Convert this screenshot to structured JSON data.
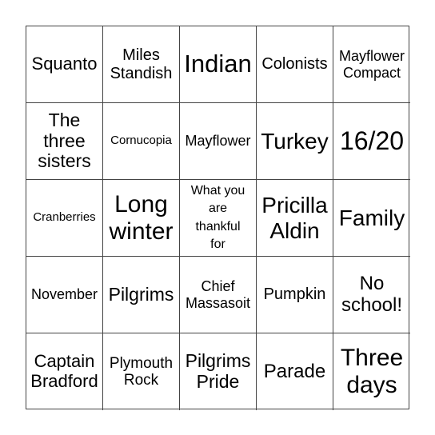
{
  "cells": [
    "Squanto",
    "Miles\nStandish",
    "Indian",
    "Colonists",
    "Mayflower\nCompact",
    "The\nthree\nsisters",
    "Cornucopia",
    "Mayflower",
    "Turkey",
    "16/20",
    "Cranberries",
    "Long\nwinter",
    "What you\nare\nthankful\nfor",
    "Pricilla\nAldin",
    "Family",
    "November",
    "Pilgrims",
    "Chief\nMassasoit",
    "Pumpkin",
    "No\nschool!",
    "Captain\nBradford",
    "Plymouth\nRock",
    "Pilgrims\nPride",
    "Parade",
    "Three\ndays"
  ]
}
